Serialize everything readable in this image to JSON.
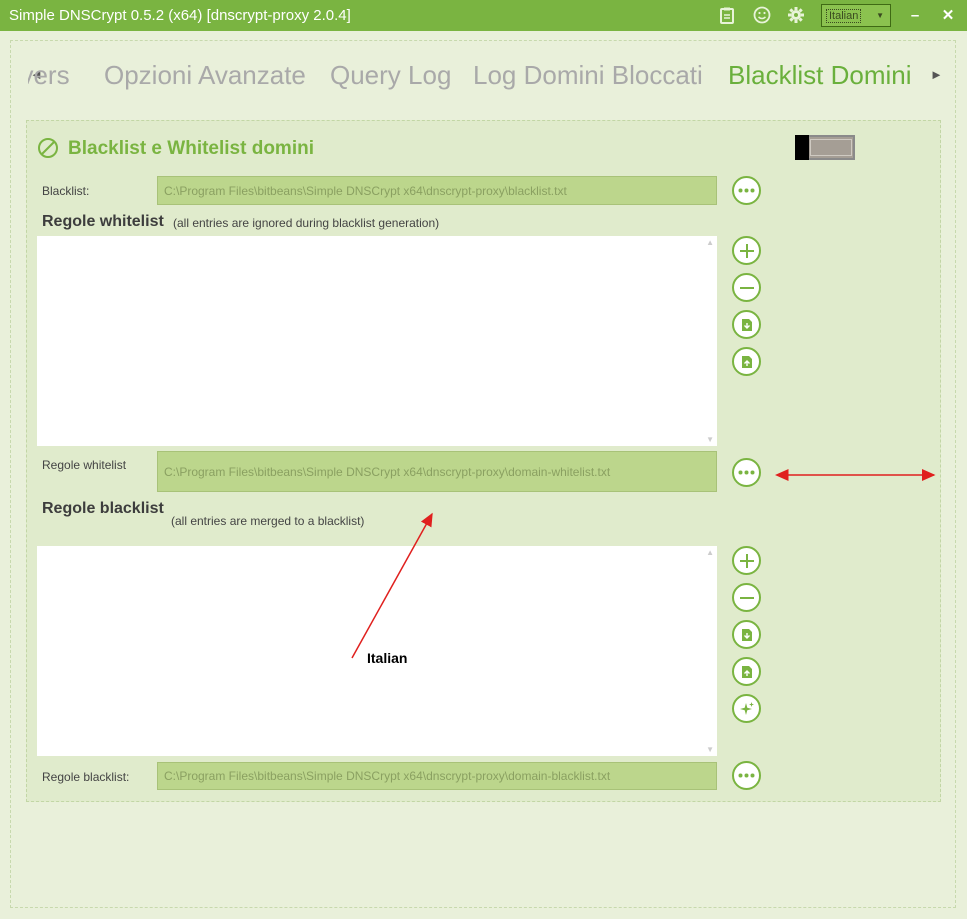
{
  "window": {
    "title": "Simple DNSCrypt 0.5.2 (x64) [dnscrypt-proxy 2.0.4]",
    "language_selected": "Italian",
    "icons": [
      "clipboard-icon",
      "smiley-icon",
      "gear-icon"
    ],
    "minimize_label": "–",
    "close_label": "✕"
  },
  "tabs": {
    "items": [
      {
        "label": "Servers"
      },
      {
        "label": "Opzioni Avanzate"
      },
      {
        "label": "Query Log"
      },
      {
        "label": "Log Domini Bloccati"
      },
      {
        "label": "Blacklist Domini"
      }
    ],
    "active_index": 4,
    "left_arrow": "◄",
    "right_arrow": "►"
  },
  "panel": {
    "title": "Blacklist e Whitelist domini",
    "blacklist_label": "Blacklist:",
    "blacklist_path": "C:\\Program Files\\bitbeans\\Simple DNSCrypt x64\\dnscrypt-proxy\\blacklist.txt",
    "whitelist_header": "Regole whitelist",
    "whitelist_note": "(all entries are ignored during blacklist generation)",
    "whitelist_file_label": "Regole whitelist",
    "whitelist_path": "C:\\Program Files\\bitbeans\\Simple DNSCrypt x64\\dnscrypt-proxy\\domain-whitelist.txt",
    "blacklist_header": "Regole blacklist",
    "blacklist_note": "(all entries are merged to a blacklist)",
    "blacklist_file_label": "Regole blacklist:",
    "blacklist_rules_path": "C:\\Program Files\\bitbeans\\Simple DNSCrypt x64\\dnscrypt-proxy\\domain-blacklist.txt"
  },
  "annotation": {
    "text": "Italian",
    "color": "#e0201e"
  },
  "colors": {
    "accent": "#7ab441",
    "titlebar": "#7ab441",
    "panel_bg": "#e0ebcc",
    "path_bg": "#bcd68c"
  }
}
